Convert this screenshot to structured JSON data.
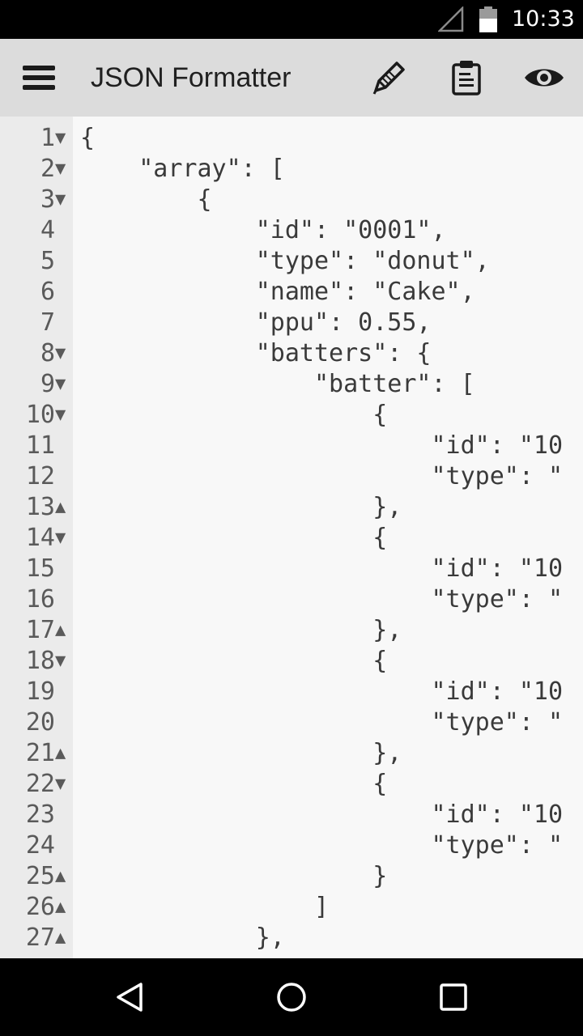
{
  "status_bar": {
    "time": "10:33",
    "icons": [
      "signal-icon",
      "battery-icon"
    ]
  },
  "app_bar": {
    "title": "JSON Formatter",
    "icons": [
      "menu-icon",
      "edit-icon",
      "clipboard-icon",
      "eye-icon"
    ]
  },
  "editor": {
    "lines": [
      {
        "num": "1",
        "fold": "▼",
        "code": "{"
      },
      {
        "num": "2",
        "fold": "▼",
        "code": "    \"array\": ["
      },
      {
        "num": "3",
        "fold": "▼",
        "code": "        {"
      },
      {
        "num": "4",
        "fold": "",
        "code": "            \"id\": \"0001\","
      },
      {
        "num": "5",
        "fold": "",
        "code": "            \"type\": \"donut\","
      },
      {
        "num": "6",
        "fold": "",
        "code": "            \"name\": \"Cake\","
      },
      {
        "num": "7",
        "fold": "",
        "code": "            \"ppu\": 0.55,"
      },
      {
        "num": "8",
        "fold": "▼",
        "code": "            \"batters\": {"
      },
      {
        "num": "9",
        "fold": "▼",
        "code": "                \"batter\": ["
      },
      {
        "num": "10",
        "fold": "▼",
        "code": "                    {"
      },
      {
        "num": "11",
        "fold": "",
        "code": "                        \"id\": \"10"
      },
      {
        "num": "12",
        "fold": "",
        "code": "                        \"type\": \""
      },
      {
        "num": "13",
        "fold": "▲",
        "code": "                    },"
      },
      {
        "num": "14",
        "fold": "▼",
        "code": "                    {"
      },
      {
        "num": "15",
        "fold": "",
        "code": "                        \"id\": \"10"
      },
      {
        "num": "16",
        "fold": "",
        "code": "                        \"type\": \""
      },
      {
        "num": "17",
        "fold": "▲",
        "code": "                    },"
      },
      {
        "num": "18",
        "fold": "▼",
        "code": "                    {"
      },
      {
        "num": "19",
        "fold": "",
        "code": "                        \"id\": \"10"
      },
      {
        "num": "20",
        "fold": "",
        "code": "                        \"type\": \""
      },
      {
        "num": "21",
        "fold": "▲",
        "code": "                    },"
      },
      {
        "num": "22",
        "fold": "▼",
        "code": "                    {"
      },
      {
        "num": "23",
        "fold": "",
        "code": "                        \"id\": \"10"
      },
      {
        "num": "24",
        "fold": "",
        "code": "                        \"type\": \""
      },
      {
        "num": "25",
        "fold": "▲",
        "code": "                    }"
      },
      {
        "num": "26",
        "fold": "▲",
        "code": "                ]"
      },
      {
        "num": "27",
        "fold": "▲",
        "code": "            },"
      }
    ]
  },
  "nav_bar": {
    "icons": [
      "back-icon",
      "home-icon",
      "recents-icon"
    ]
  },
  "colors": {
    "status_bar_bg": "#000000",
    "app_bar_bg": "#dcdcdc",
    "gutter_bg": "#ebebeb",
    "editor_bg": "#f8f8f8",
    "code_text": "#3a3a3a"
  }
}
